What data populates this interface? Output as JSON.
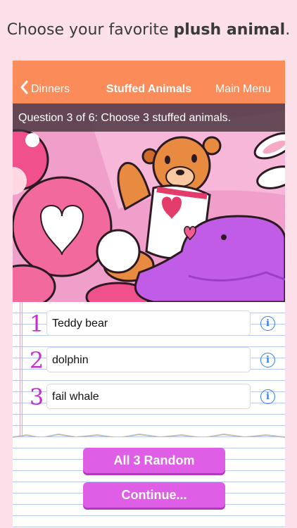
{
  "caption": {
    "prefix": "Choose your favorite ",
    "bold": "plush animal",
    "suffix": "."
  },
  "navbar": {
    "back_label": "Dinners",
    "title": "Stuffed Animals",
    "menu_label": "Main Menu",
    "color": "#fb8b58"
  },
  "question": {
    "text": "Question 3 of 6: Choose 3 stuffed animals."
  },
  "answers": [
    {
      "number": "1",
      "value": "Teddy bear"
    },
    {
      "number": "2",
      "value": "dolphin"
    },
    {
      "number": "3",
      "value": "fail whale"
    }
  ],
  "buttons": {
    "random_label": "All 3 Random",
    "continue_label": "Continue..."
  },
  "colors": {
    "accent": "#de5fe6",
    "number": "#c52fcf",
    "info": "#2d7cf6"
  }
}
